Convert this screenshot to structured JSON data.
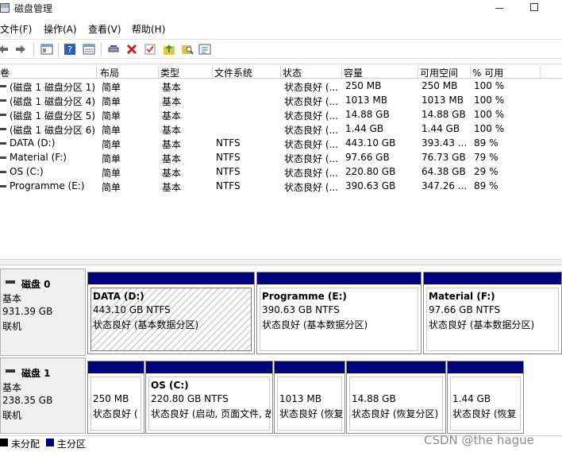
{
  "window": {
    "title": "磁盘管理"
  },
  "menu": [
    "文件(F)",
    "操作(A)",
    "查看(V)",
    "帮助(H)"
  ],
  "toolbar_icons": [
    "back-arrow-icon",
    "forward-arrow-icon",
    "console-tree-icon",
    "help-icon",
    "properties-icon",
    "connect-drive-icon",
    "delete-icon",
    "check-icon",
    "folder-up-icon",
    "search-folder-icon",
    "settings-list-icon"
  ],
  "volume_list": {
    "columns": [
      "卷",
      "布局",
      "类型",
      "文件系统",
      "状态",
      "容量",
      "可用空间",
      "% 可用"
    ],
    "rows": [
      [
        "(磁盘 1 磁盘分区 1)",
        "简单",
        "基本",
        "",
        "状态良好 (...",
        "250 MB",
        "250 MB",
        "100 %"
      ],
      [
        "(磁盘 1 磁盘分区 4)",
        "简单",
        "基本",
        "",
        "状态良好 (...",
        "1013 MB",
        "1013 MB",
        "100 %"
      ],
      [
        "(磁盘 1 磁盘分区 5)",
        "简单",
        "基本",
        "",
        "状态良好 (...",
        "14.88 GB",
        "14.88 GB",
        "100 %"
      ],
      [
        "(磁盘 1 磁盘分区 6)",
        "简单",
        "基本",
        "",
        "状态良好 (...",
        "1.44 GB",
        "1.44 GB",
        "100 %"
      ],
      [
        "DATA (D:)",
        "简单",
        "基本",
        "NTFS",
        "状态良好 (...",
        "443.10 GB",
        "393.43 ...",
        "89 %"
      ],
      [
        "Material (F:)",
        "简单",
        "基本",
        "NTFS",
        "状态良好 (...",
        "97.66 GB",
        "76.73 GB",
        "79 %"
      ],
      [
        "OS (C:)",
        "简单",
        "基本",
        "NTFS",
        "状态良好 (...",
        "220.80 GB",
        "64.38 GB",
        "29 %"
      ],
      [
        "Programme (E:)",
        "简单",
        "基本",
        "NTFS",
        "状态良好 (...",
        "390.63 GB",
        "347.26 ...",
        "89 %"
      ]
    ]
  },
  "disks": [
    {
      "name": "磁盘 0",
      "type": "基本",
      "size": "931.39 GB",
      "status": "联机",
      "partitions": [
        {
          "name": "DATA  (D:)",
          "size": "443.10 GB NTFS",
          "status": "状态良好 (基本数据分区)"
        },
        {
          "name": "Programme  (E:)",
          "size": "390.63 GB NTFS",
          "status": "状态良好 (基本数据分区)"
        },
        {
          "name": "Material  (F:)",
          "size": "97.66 GB NTFS",
          "status": "状态良好 (基本数据分区)"
        }
      ]
    },
    {
      "name": "磁盘 1",
      "type": "基本",
      "size": "238.35 GB",
      "status": "联机",
      "partitions": [
        {
          "name": "",
          "size": "250 MB",
          "status": "状态良好 ("
        },
        {
          "name": "OS  (C:)",
          "size": "220.80 GB NTFS",
          "status": "状态良好 (启动, 页面文件, 故"
        },
        {
          "name": "",
          "size": "1013 MB",
          "status": "状态良好 (恢复"
        },
        {
          "name": "",
          "size": "14.88 GB",
          "status": "状态良好 (恢复分区)"
        },
        {
          "name": "",
          "size": "1.44 GB",
          "status": "状态良好 (恢复"
        }
      ]
    }
  ],
  "legend": [
    {
      "label": "未分配",
      "color": "#000000"
    },
    {
      "label": "主分区",
      "color": "#000080"
    }
  ],
  "watermark": "CSDN @the hague"
}
